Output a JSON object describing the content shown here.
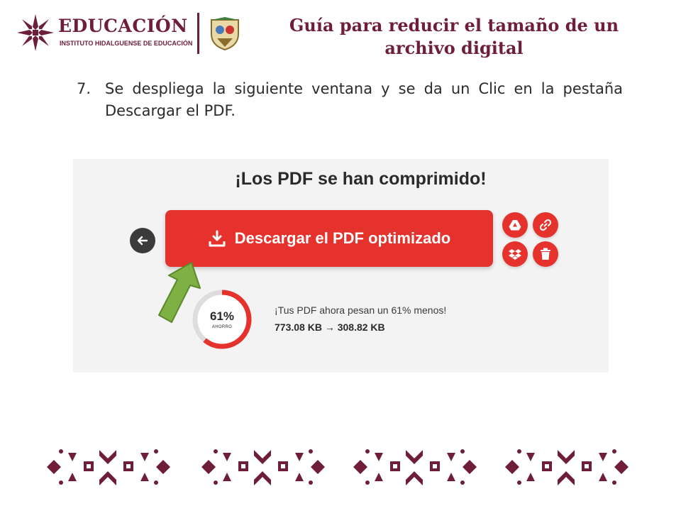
{
  "header": {
    "logo_word": "EDUCACIÓN",
    "logo_sub": "INSTITUTO HIDALGUENSE DE EDUCACIÓN",
    "title_line1": "Guía para reducir el tamaño de un",
    "title_line2": "archivo digital"
  },
  "instruction": {
    "number": "7.",
    "text": "Se despliega la siguiente ventana y se da un Clic en la pestaña Descargar el PDF."
  },
  "screenshot": {
    "heading": "¡Los PDF se han comprimido!",
    "download_label": "Descargar el PDF optimizado",
    "actions": [
      "google-drive-icon",
      "link-icon",
      "dropbox-icon",
      "trash-icon"
    ],
    "savings_percent_text": "61%",
    "savings_percent": 61,
    "savings_label": "AHORRO",
    "savings_message": "¡Tus PDF ahora pesan un 61% menos!",
    "size_before": "773.08 KB",
    "size_after": "308.82 KB"
  },
  "colors": {
    "brand": "#6e1d3b",
    "accent_red": "#e5322d",
    "pointer_green": "#7fb043"
  }
}
